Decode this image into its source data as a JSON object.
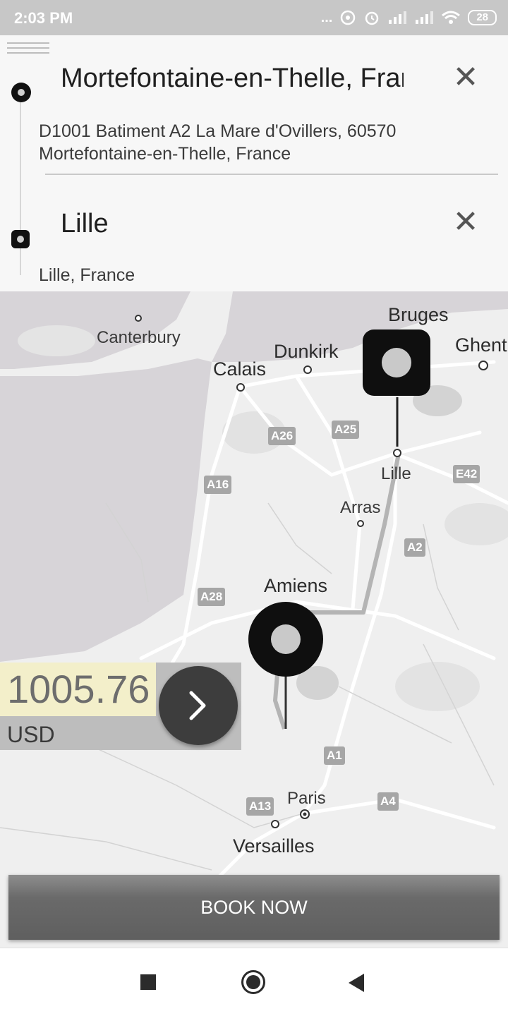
{
  "status_bar": {
    "time": "2:03 PM",
    "dots": "...",
    "battery": "28"
  },
  "route": {
    "origin_title": "Mortefontaine-en-Thelle, France",
    "origin_address_line1": "D1001 Batiment A2 La Mare d'Ovillers, 60570",
    "origin_address_line2": "Mortefontaine-en-Thelle, France",
    "destination_title": "Lille",
    "destination_address": "Lille, France",
    "clear_symbol": "✕"
  },
  "map": {
    "cities": {
      "canterbury": "Canterbury",
      "calais": "Calais",
      "dunkirk": "Dunkirk",
      "bruges": "Bruges",
      "ghent": "Ghent",
      "lille": "Lille",
      "arras": "Arras",
      "amiens": "Amiens",
      "paris": "Paris",
      "versailles": "Versailles"
    },
    "roads": {
      "a26": "A26",
      "a25": "A25",
      "a16": "A16",
      "e42": "E42",
      "a2": "A2",
      "a28": "A28",
      "a1": "A1",
      "a13": "A13",
      "a4": "A4"
    }
  },
  "fare": {
    "amount": "1005.76",
    "currency": "USD"
  },
  "book_button": {
    "label": "BOOK NOW"
  }
}
